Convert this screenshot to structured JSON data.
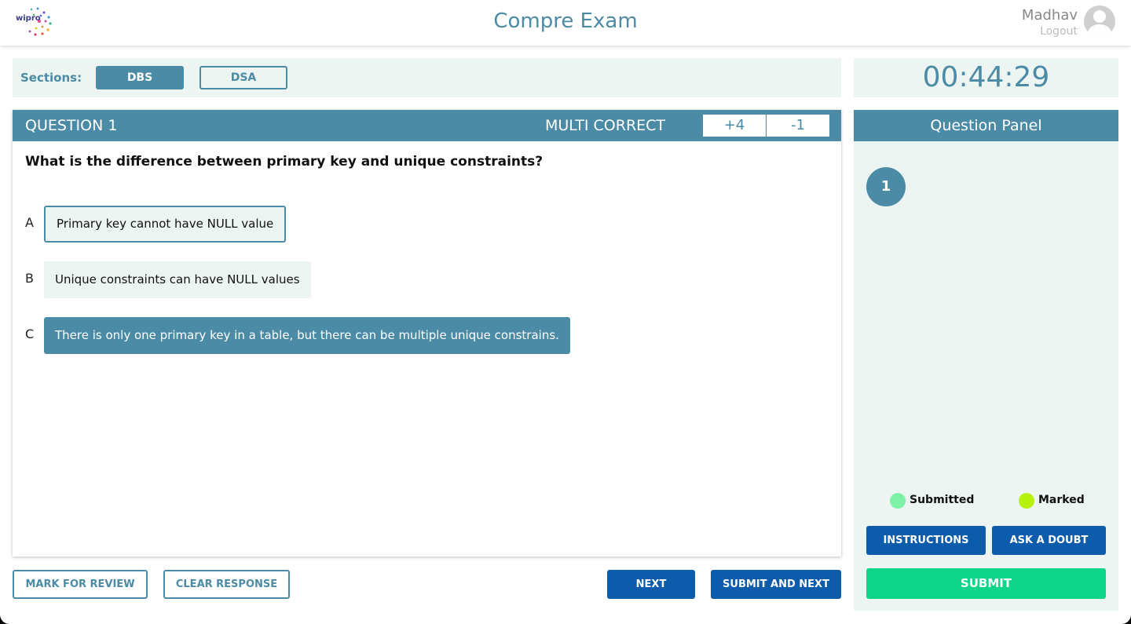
{
  "header": {
    "logo_text": "wipro",
    "title": "Compre Exam",
    "user_name": "Madhav",
    "logout_label": "Logout"
  },
  "sections": {
    "label": "Sections:",
    "items": [
      {
        "label": "DBS",
        "active": true
      },
      {
        "label": "DSA",
        "active": false
      }
    ]
  },
  "timer": "00:44:29",
  "question": {
    "number_label": "QUESTION 1",
    "type_label": "MULTI CORRECT",
    "positive_marks": "+4",
    "negative_marks": "-1",
    "text": "What is the difference between primary key and unique constraints?",
    "options": [
      {
        "letter": "A",
        "text": "Primary key cannot have NULL value"
      },
      {
        "letter": "B",
        "text": "Unique constraints can have NULL values"
      },
      {
        "letter": "C",
        "text": "There is only one primary key in a table, but there can be multiple unique constrains."
      }
    ]
  },
  "actions": {
    "mark_for_review": "MARK FOR REVIEW",
    "clear_response": "CLEAR RESPONSE",
    "next": "NEXT",
    "submit_and_next": "SUBMIT AND NEXT"
  },
  "question_panel": {
    "title": "Question Panel",
    "questions": [
      "1"
    ],
    "legend": [
      {
        "label": "Submitted",
        "color": "#7ef2a6"
      },
      {
        "label": "Marked",
        "color": "#b7f20f"
      }
    ],
    "instructions_label": "INSTRUCTIONS",
    "ask_doubt_label": "ASK A DOUBT",
    "submit_label": "SUBMIT"
  },
  "colors": {
    "accent": "#4b8ba5",
    "panel_bg": "#edf5f3",
    "primary_button": "#0d5cab",
    "submit_button": "#0fd58a"
  }
}
